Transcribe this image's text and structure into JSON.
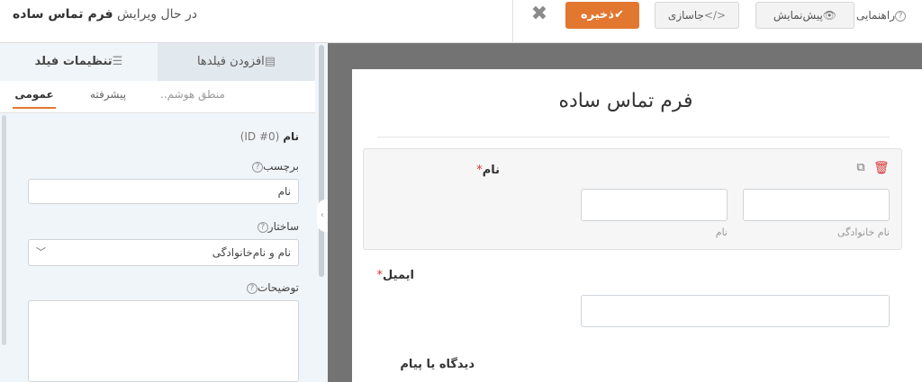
{
  "topbar": {
    "editing_prefix": "در حال ویرایش",
    "form_name": "فرم تماس ساده",
    "save_label": "ذخیره",
    "embed_label": "جاسازی",
    "preview_label": "پیش‌نمایش",
    "help_label": "راهنمایی",
    "close_icon": "close-icon",
    "save_icon": "check-icon"
  },
  "panel": {
    "tabs": {
      "settings": "تنظیمات فیلد",
      "add": "افزودن فیلدها"
    },
    "subtabs": {
      "general": "عمومی",
      "advanced": "پیشرفته",
      "logic": "منطق هوشم.."
    },
    "field_title": "نام",
    "field_id": "(ID #0)",
    "label_label": "برچسب",
    "label_value": "نام",
    "format_label": "ساختار",
    "format_value": "نام و نام‌خانوادگی",
    "description_label": "توضیحات"
  },
  "form": {
    "title": "فرم تماس ساده",
    "name_label": "نام",
    "required_mark": "*",
    "first_sublabel": "نام",
    "last_sublabel": "نام خانوادگی",
    "email_label": "ایمیل",
    "message_label": "دیدگاه یا پیام"
  },
  "colors": {
    "accent": "#e27730",
    "required": "#d63638",
    "canvas_bg": "#737373"
  }
}
